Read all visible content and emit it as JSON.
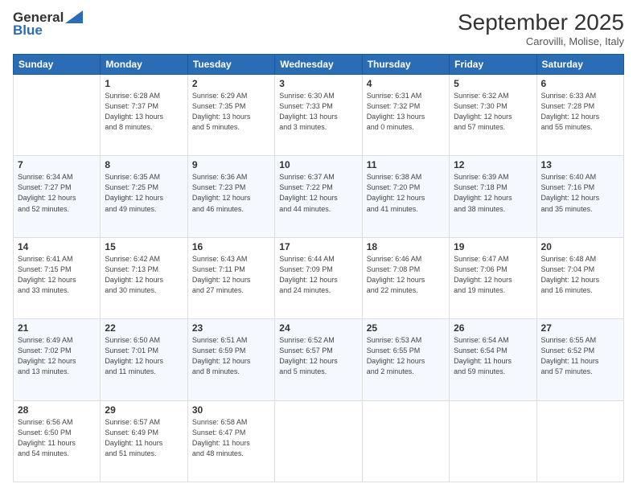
{
  "header": {
    "logo_line1": "General",
    "logo_line2": "Blue",
    "month_title": "September 2025",
    "subtitle": "Carovilli, Molise, Italy"
  },
  "days_of_week": [
    "Sunday",
    "Monday",
    "Tuesday",
    "Wednesday",
    "Thursday",
    "Friday",
    "Saturday"
  ],
  "weeks": [
    [
      {
        "day": "",
        "info": ""
      },
      {
        "day": "1",
        "info": "Sunrise: 6:28 AM\nSunset: 7:37 PM\nDaylight: 13 hours\nand 8 minutes."
      },
      {
        "day": "2",
        "info": "Sunrise: 6:29 AM\nSunset: 7:35 PM\nDaylight: 13 hours\nand 5 minutes."
      },
      {
        "day": "3",
        "info": "Sunrise: 6:30 AM\nSunset: 7:33 PM\nDaylight: 13 hours\nand 3 minutes."
      },
      {
        "day": "4",
        "info": "Sunrise: 6:31 AM\nSunset: 7:32 PM\nDaylight: 13 hours\nand 0 minutes."
      },
      {
        "day": "5",
        "info": "Sunrise: 6:32 AM\nSunset: 7:30 PM\nDaylight: 12 hours\nand 57 minutes."
      },
      {
        "day": "6",
        "info": "Sunrise: 6:33 AM\nSunset: 7:28 PM\nDaylight: 12 hours\nand 55 minutes."
      }
    ],
    [
      {
        "day": "7",
        "info": "Sunrise: 6:34 AM\nSunset: 7:27 PM\nDaylight: 12 hours\nand 52 minutes."
      },
      {
        "day": "8",
        "info": "Sunrise: 6:35 AM\nSunset: 7:25 PM\nDaylight: 12 hours\nand 49 minutes."
      },
      {
        "day": "9",
        "info": "Sunrise: 6:36 AM\nSunset: 7:23 PM\nDaylight: 12 hours\nand 46 minutes."
      },
      {
        "day": "10",
        "info": "Sunrise: 6:37 AM\nSunset: 7:22 PM\nDaylight: 12 hours\nand 44 minutes."
      },
      {
        "day": "11",
        "info": "Sunrise: 6:38 AM\nSunset: 7:20 PM\nDaylight: 12 hours\nand 41 minutes."
      },
      {
        "day": "12",
        "info": "Sunrise: 6:39 AM\nSunset: 7:18 PM\nDaylight: 12 hours\nand 38 minutes."
      },
      {
        "day": "13",
        "info": "Sunrise: 6:40 AM\nSunset: 7:16 PM\nDaylight: 12 hours\nand 35 minutes."
      }
    ],
    [
      {
        "day": "14",
        "info": "Sunrise: 6:41 AM\nSunset: 7:15 PM\nDaylight: 12 hours\nand 33 minutes."
      },
      {
        "day": "15",
        "info": "Sunrise: 6:42 AM\nSunset: 7:13 PM\nDaylight: 12 hours\nand 30 minutes."
      },
      {
        "day": "16",
        "info": "Sunrise: 6:43 AM\nSunset: 7:11 PM\nDaylight: 12 hours\nand 27 minutes."
      },
      {
        "day": "17",
        "info": "Sunrise: 6:44 AM\nSunset: 7:09 PM\nDaylight: 12 hours\nand 24 minutes."
      },
      {
        "day": "18",
        "info": "Sunrise: 6:46 AM\nSunset: 7:08 PM\nDaylight: 12 hours\nand 22 minutes."
      },
      {
        "day": "19",
        "info": "Sunrise: 6:47 AM\nSunset: 7:06 PM\nDaylight: 12 hours\nand 19 minutes."
      },
      {
        "day": "20",
        "info": "Sunrise: 6:48 AM\nSunset: 7:04 PM\nDaylight: 12 hours\nand 16 minutes."
      }
    ],
    [
      {
        "day": "21",
        "info": "Sunrise: 6:49 AM\nSunset: 7:02 PM\nDaylight: 12 hours\nand 13 minutes."
      },
      {
        "day": "22",
        "info": "Sunrise: 6:50 AM\nSunset: 7:01 PM\nDaylight: 12 hours\nand 11 minutes."
      },
      {
        "day": "23",
        "info": "Sunrise: 6:51 AM\nSunset: 6:59 PM\nDaylight: 12 hours\nand 8 minutes."
      },
      {
        "day": "24",
        "info": "Sunrise: 6:52 AM\nSunset: 6:57 PM\nDaylight: 12 hours\nand 5 minutes."
      },
      {
        "day": "25",
        "info": "Sunrise: 6:53 AM\nSunset: 6:55 PM\nDaylight: 12 hours\nand 2 minutes."
      },
      {
        "day": "26",
        "info": "Sunrise: 6:54 AM\nSunset: 6:54 PM\nDaylight: 11 hours\nand 59 minutes."
      },
      {
        "day": "27",
        "info": "Sunrise: 6:55 AM\nSunset: 6:52 PM\nDaylight: 11 hours\nand 57 minutes."
      }
    ],
    [
      {
        "day": "28",
        "info": "Sunrise: 6:56 AM\nSunset: 6:50 PM\nDaylight: 11 hours\nand 54 minutes."
      },
      {
        "day": "29",
        "info": "Sunrise: 6:57 AM\nSunset: 6:49 PM\nDaylight: 11 hours\nand 51 minutes."
      },
      {
        "day": "30",
        "info": "Sunrise: 6:58 AM\nSunset: 6:47 PM\nDaylight: 11 hours\nand 48 minutes."
      },
      {
        "day": "",
        "info": ""
      },
      {
        "day": "",
        "info": ""
      },
      {
        "day": "",
        "info": ""
      },
      {
        "day": "",
        "info": ""
      }
    ]
  ]
}
